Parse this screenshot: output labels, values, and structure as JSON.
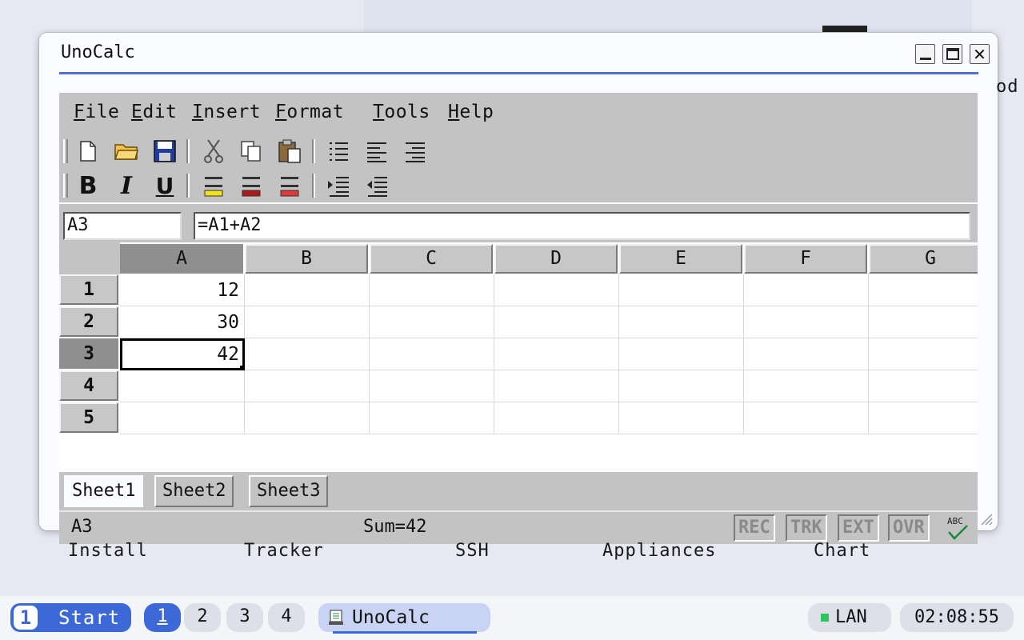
{
  "window": {
    "title": "UnoCalc"
  },
  "menu": [
    "File",
    "Edit",
    "Insert",
    "Format",
    "Tools",
    "Help"
  ],
  "toolbar1_icons": [
    "new-document-icon",
    "open-folder-icon",
    "save-icon",
    "cut-icon",
    "copy-icon",
    "paste-icon",
    "bulleted-list-icon",
    "align-left-icon",
    "align-right-icon"
  ],
  "toolbar2_icons": [
    "bold-icon",
    "italic-icon",
    "underline-icon",
    "highlight-yellow-icon",
    "highlight-red-icon",
    "font-color-red-icon",
    "indent-increase-icon",
    "indent-decrease-icon"
  ],
  "formula": {
    "cell_ref": "A3",
    "content": "=A1+A2"
  },
  "grid": {
    "columns": [
      "A",
      "B",
      "C",
      "D",
      "E",
      "F",
      "G"
    ],
    "rows": [
      "1",
      "2",
      "3",
      "4",
      "5"
    ],
    "values": {
      "A1": "12",
      "A2": "30",
      "A3": "42"
    },
    "active_cell": "A3"
  },
  "sheets": [
    "Sheet1",
    "Sheet2",
    "Sheet3"
  ],
  "status": {
    "cell": "A3",
    "sum": "Sum=42",
    "indicators": [
      "REC",
      "TRK",
      "EXT",
      "OVR"
    ],
    "spell_label": "ABC"
  },
  "desktop_labels": [
    "Install",
    "Tracker",
    "SSH",
    "Appliances",
    "Chart",
    "od"
  ],
  "taskbar": {
    "start_number": "1",
    "start_label": "Start",
    "workspaces": [
      "1",
      "2",
      "3",
      "4"
    ],
    "task": "UnoCalc",
    "network": "LAN",
    "clock": "02:08:55",
    "colors": {
      "accent": "#3d68d8",
      "task_bg": "#c9d4f4",
      "lan_ok": "#2ec45a"
    }
  }
}
